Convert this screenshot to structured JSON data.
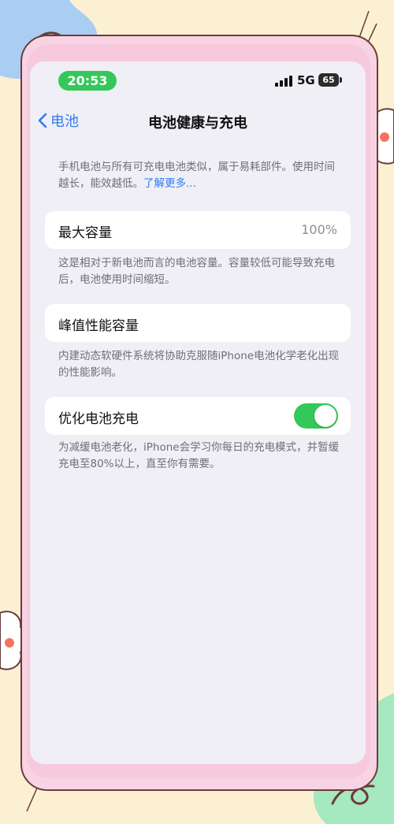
{
  "status": {
    "time": "20:53",
    "network": "5G",
    "battery": "65"
  },
  "nav": {
    "back_label": "电池",
    "title": "电池健康与充电"
  },
  "intro": {
    "text": "手机电池与所有可充电电池类似，属于易耗部件。使用时间越长，能效越低。",
    "link": "了解更多..."
  },
  "max_capacity": {
    "label": "最大容量",
    "value": "100%",
    "note": "这是相对于新电池而言的电池容量。容量较低可能导致充电后，电池使用时间缩短。"
  },
  "peak_performance": {
    "label": "峰值性能容量",
    "note": "内建动态软硬件系统将协助克服随iPhone电池化学老化出现的性能影响。"
  },
  "optimized_charging": {
    "label": "优化电池充电",
    "enabled": true,
    "note": "为减缓电池老化，iPhone会学习你每日的充电模式，并暂缓充电至80%以上，直至你有需要。"
  },
  "colors": {
    "accent": "#2f7bf5",
    "toggle_on": "#34c759",
    "background": "#fbf1d2"
  }
}
